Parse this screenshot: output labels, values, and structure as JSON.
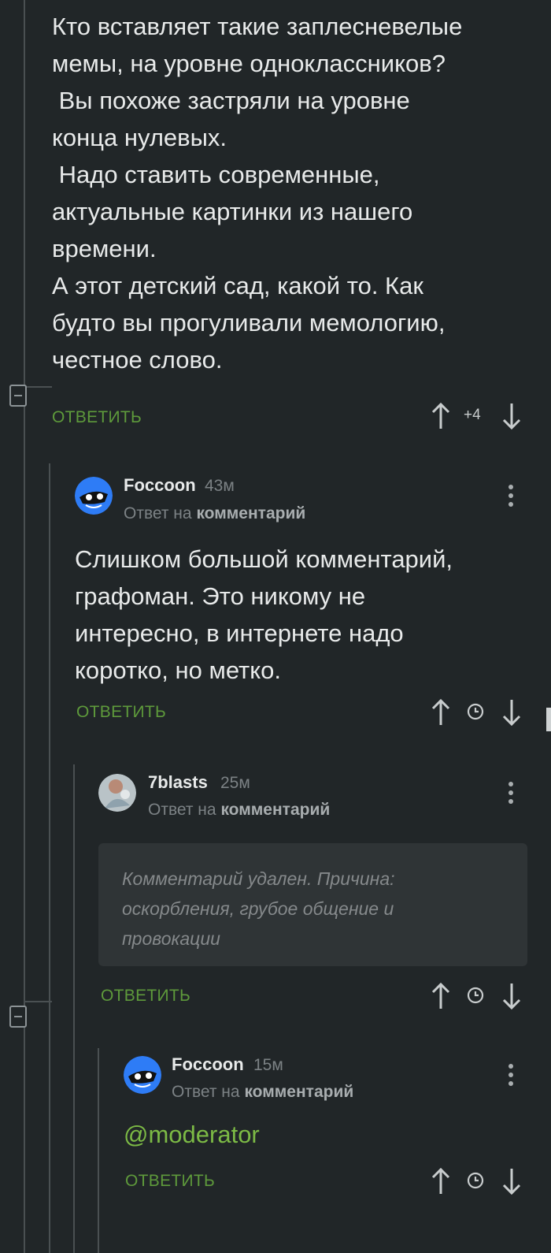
{
  "top_comment": {
    "text": "Кто вставляет такие заплесневелые\nмемы, на уровне одноклассников?\n Вы похоже застряли на уровне\nконца нулевых.\n Надо ставить современные,\nактуальные картинки из нашего\nвремени.\nА этот детский сад, какой то. Как\nбудто вы прогуливали мемологию,\nчестное слово.",
    "reply_label": "ОТВЕТИТЬ",
    "score": "+4"
  },
  "comment_1": {
    "author": "Foccoon",
    "time": "43м",
    "reply_prefix": "Ответ на",
    "reply_target": "комментарий",
    "text": "Слишком большой комментарий,\nграфоман. Это никому не\nинтересно, в интернете надо\nкоротко, но метко.",
    "reply_label": "ОТВЕТИТЬ"
  },
  "comment_2": {
    "author": "7blasts",
    "time": "25м",
    "reply_prefix": "Ответ на",
    "reply_target": "комментарий",
    "deleted_text": "Комментарий удален. Причина:\nоскорбления, грубое общение и\nпровокации",
    "reply_label": "ОТВЕТИТЬ"
  },
  "comment_3": {
    "author": "Foccoon",
    "time": "15м",
    "reply_prefix": "Ответ на",
    "reply_target": "комментарий",
    "text": "@moderator",
    "reply_label": "ОТВЕТИТЬ"
  },
  "colors": {
    "background": "#212628",
    "accent_green": "#5e9a3b",
    "mention_green": "#7cba45",
    "avatar_blue": "#2e7cf6"
  },
  "icons": [
    "collapse-icon",
    "upvote-arrow-icon",
    "downvote-arrow-icon",
    "clock-icon",
    "more-dots-icon",
    "avatar"
  ]
}
